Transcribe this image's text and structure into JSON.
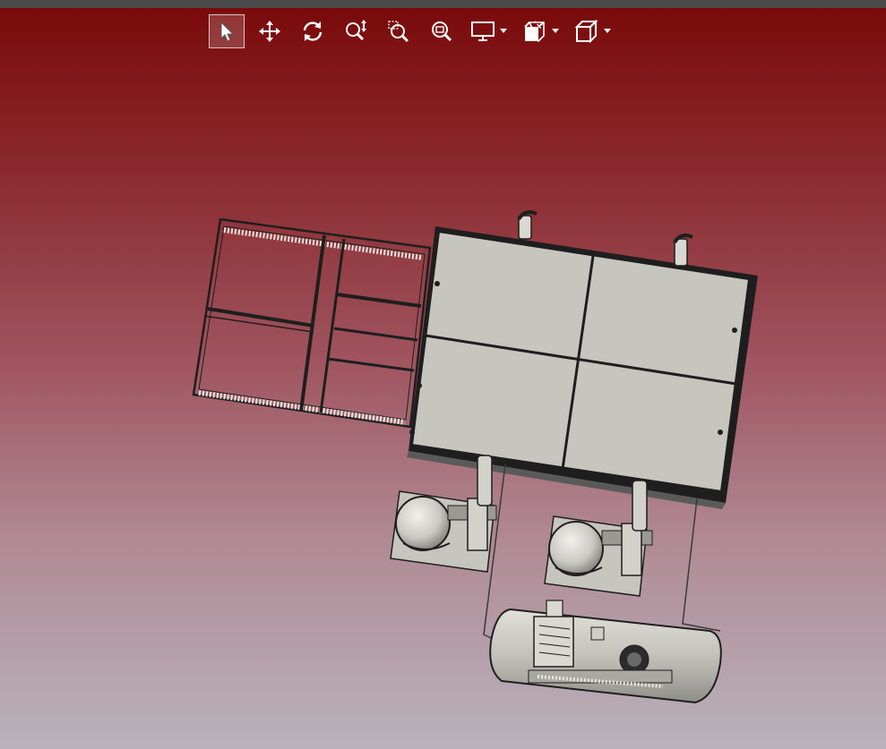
{
  "window": {
    "title_bar_color": "#4a4a4a"
  },
  "viewport": {
    "background_top": "#7a0a0b",
    "background_bottom": "#b9b2bb"
  },
  "toolbar": {
    "tools": [
      {
        "name": "select-tool",
        "icon": "arrow-pointer-icon",
        "active": true
      },
      {
        "name": "pan-tool",
        "icon": "move-arrows-icon",
        "active": false
      },
      {
        "name": "rotate-tool",
        "icon": "rotate-icon",
        "active": false
      },
      {
        "name": "zoom-in-out-tool",
        "icon": "zoom-in-out-icon",
        "active": false
      },
      {
        "name": "zoom-to-area-tool",
        "icon": "zoom-area-icon",
        "active": false
      },
      {
        "name": "zoom-to-fit-tool",
        "icon": "zoom-fit-icon",
        "active": false
      }
    ],
    "dropdowns": [
      {
        "name": "display-style-dropdown",
        "icon": "monitor-icon"
      },
      {
        "name": "section-view-dropdown",
        "icon": "section-view-icon"
      },
      {
        "name": "view-orientation-dropdown",
        "icon": "cube-icon"
      }
    ],
    "icon_color": "#ffffff"
  },
  "model": {
    "part_color": "#c6c5be",
    "edge_color": "#1e1e1e"
  }
}
